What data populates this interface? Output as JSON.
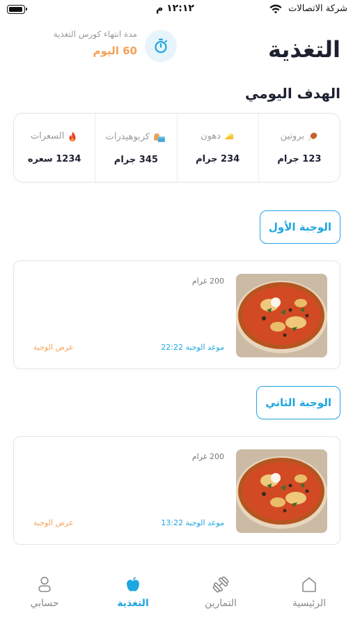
{
  "status_bar": {
    "carrier": "شركة الاتصالات",
    "time": "١٢:١٢ م"
  },
  "header": {
    "title": "التغذية",
    "course_label": "مدة انتهاء كورس التغذية",
    "course_days": "60 اليوم"
  },
  "daily_goal": {
    "title": "الهدف اليومي",
    "items": [
      {
        "icon": "drumstick-icon",
        "label": "بروتين",
        "value": "123 جرام"
      },
      {
        "icon": "cheese-icon",
        "label": "دهون",
        "value": "234 جرام"
      },
      {
        "icon": "bread-icon",
        "label": "كربوهيدرات",
        "value": "345 جرام"
      },
      {
        "icon": "fire-icon",
        "label": "السعرات",
        "value": "1234 سعره"
      }
    ]
  },
  "meals": [
    {
      "tag": "الوجبة الأول",
      "grams": "200 غرام",
      "time": "موعد الوجبة 22:22",
      "view_label": "عرض الوجبة"
    },
    {
      "tag": "الوجبة الثاني",
      "grams": "200 غرام",
      "time": "موعد الوجبة 13:22",
      "view_label": "عرض الوجبة"
    }
  ],
  "bottom_nav": {
    "items": [
      {
        "label": "الرئيسية",
        "icon": "home-icon",
        "active": false
      },
      {
        "label": "التمارين",
        "icon": "dumbbell-icon",
        "active": false
      },
      {
        "label": "التغذية",
        "icon": "apple-icon",
        "active": true
      },
      {
        "label": "حسابي",
        "icon": "user-icon",
        "active": false
      }
    ]
  },
  "colors": {
    "accent": "#1ea6e0",
    "orange": "#f5a15a",
    "text": "#1d2130"
  }
}
